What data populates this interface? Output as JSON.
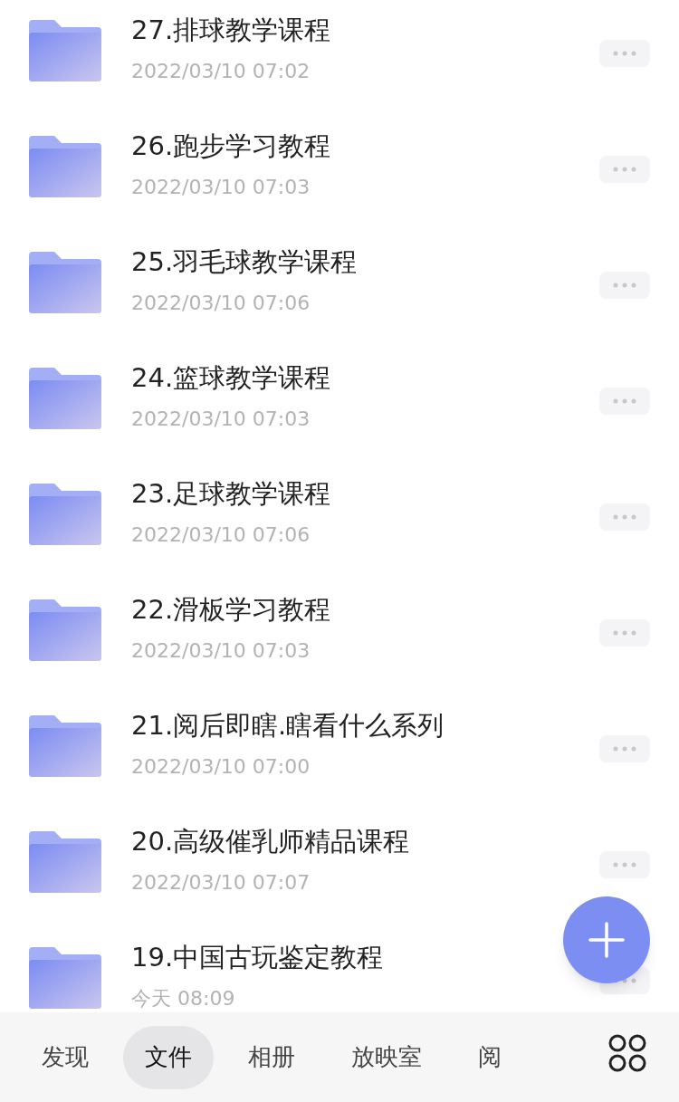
{
  "files": [
    {
      "name": "27.排球教学课程",
      "date": "2022/03/10 07:02"
    },
    {
      "name": "26.跑步学习教程",
      "date": "2022/03/10 07:03"
    },
    {
      "name": "25.羽毛球教学课程",
      "date": "2022/03/10 07:06"
    },
    {
      "name": "24.篮球教学课程",
      "date": "2022/03/10 07:03"
    },
    {
      "name": "23.足球教学课程",
      "date": "2022/03/10 07:06"
    },
    {
      "name": "22.滑板学习教程",
      "date": "2022/03/10 07:03"
    },
    {
      "name": "21.阅后即瞎.瞎看什么系列",
      "date": "2022/03/10 07:00"
    },
    {
      "name": "20.高级催乳师精品课程",
      "date": "2022/03/10 07:07"
    },
    {
      "name": "19.中国古玩鉴定教程",
      "date": "今天 08:09"
    }
  ],
  "tabs": [
    {
      "label": "发现",
      "selected": false
    },
    {
      "label": "文件",
      "selected": true
    },
    {
      "label": "相册",
      "selected": false
    },
    {
      "label": "放映室",
      "selected": false
    },
    {
      "label": "阅",
      "selected": false
    }
  ]
}
